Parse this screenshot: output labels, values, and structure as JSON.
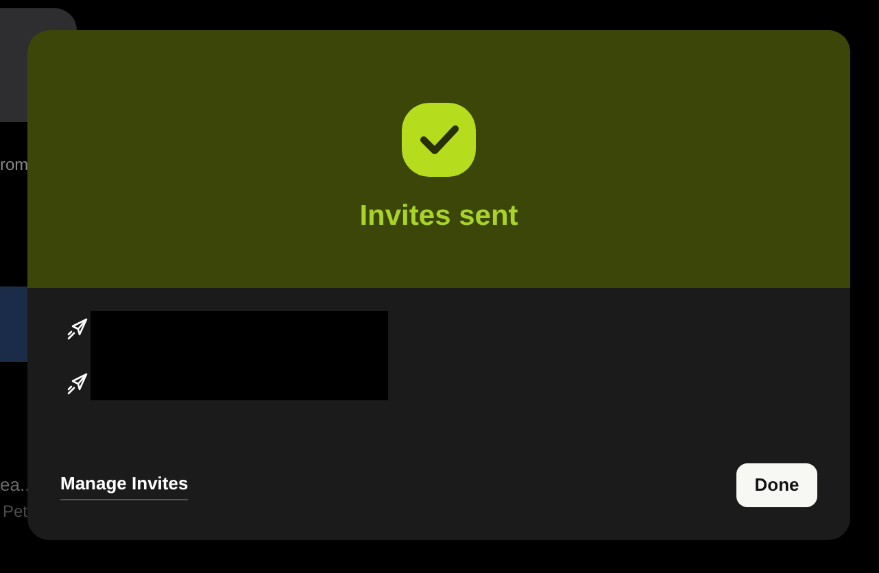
{
  "background": {
    "texts": [
      "rom",
      "ea..",
      "Pet"
    ]
  },
  "dialog": {
    "title": "Invites sent",
    "invites": [
      {
        "kind": "sent"
      },
      {
        "kind": "sent"
      }
    ],
    "redacted": true,
    "link": "Manage Invites",
    "button": "Done"
  }
}
